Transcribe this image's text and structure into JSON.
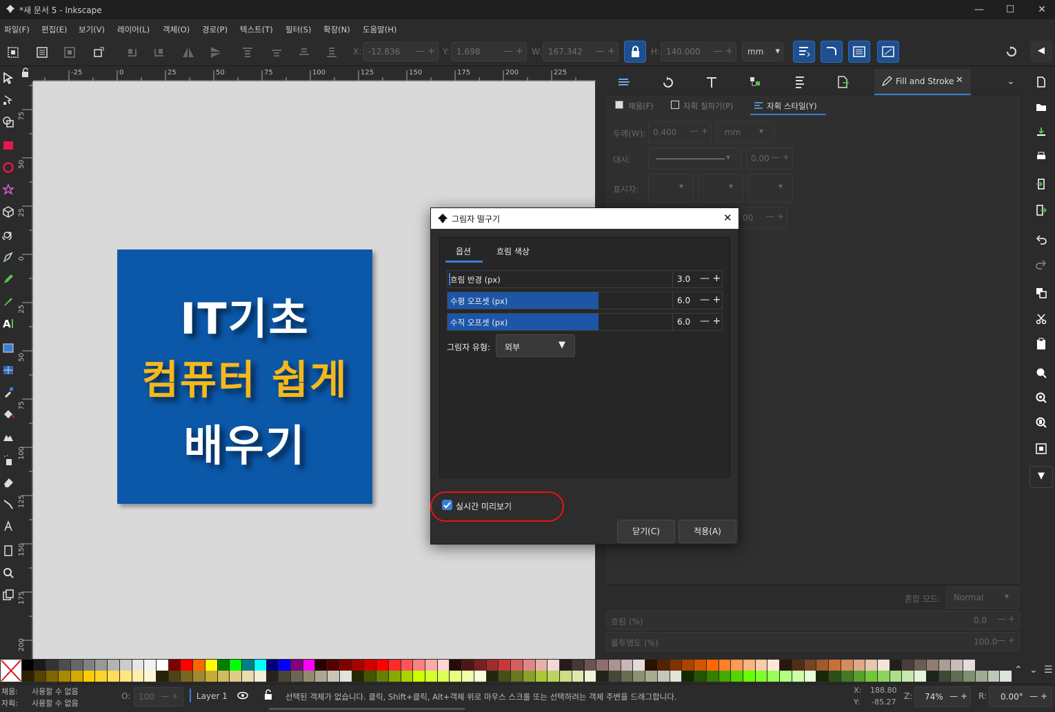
{
  "window": {
    "title": "*새 문서 5 - Inkscape",
    "minimize": "—",
    "maximize": "☐",
    "close": "✕"
  },
  "menu": [
    "파일(F)",
    "편집(E)",
    "보기(V)",
    "레이어(L)",
    "객체(O)",
    "경로(P)",
    "텍스트(T)",
    "필터(S)",
    "확장(N)",
    "도움말(H)"
  ],
  "toolbar": {
    "x_label": "X:",
    "x_value": "-12.836",
    "y_label": "Y:",
    "y_value": "1.698",
    "w_label": "W:",
    "w_value": "167.342",
    "h_label": "H:",
    "h_value": "140.000",
    "unit": "mm"
  },
  "ruler_top": [
    "-25",
    "0",
    "25",
    "50",
    "75",
    "100",
    "125",
    "150",
    "175",
    "200",
    "225"
  ],
  "ruler_left": [
    "75",
    "50",
    "25",
    "0",
    "25",
    "50",
    "75",
    "100",
    "125",
    "150",
    "175",
    "200"
  ],
  "artwork": {
    "line1": "IT기초",
    "line2": "컴퓨터 쉽게",
    "line3": "배우기",
    "box_color": "#0b57a8",
    "accent": "#f5b81b"
  },
  "dock": {
    "active_tab": "Fill and Stroke",
    "subtabs": [
      "채움(F)",
      "자획 칠하기(P)",
      "자획 스타일(Y)"
    ],
    "width_label": "두께(W):",
    "width_value": "0.400",
    "width_unit": "mm",
    "dash_label": "대시:",
    "dash_value": "0.00",
    "marker_label": "표시자:",
    "partial_value": "00",
    "blend_label": "혼합 모드:",
    "blend_value": "Normal",
    "blur_label": "흐림 (%)",
    "blur_value": "0.0",
    "opacity_label": "불투명도 (%)",
    "opacity_value": "100.0"
  },
  "dialog": {
    "title": "그림자 떨구기",
    "tabs": [
      "옵션",
      "흐림 색상"
    ],
    "blur_radius_label": "흐림 반경 (px)",
    "blur_radius_value": "3.0",
    "blur_radius_fraction": 0.0,
    "h_offset_label": "수평 오프셋 (px)",
    "h_offset_value": "6.0",
    "h_offset_fraction": 0.55,
    "v_offset_label": "수직 오프셋 (px)",
    "v_offset_value": "6.0",
    "v_offset_fraction": 0.55,
    "shadow_type_label": "그림자 유형:",
    "shadow_type_value": "외부",
    "live_preview_label": "실시간 미리보기",
    "close_button": "닫기(C)",
    "apply_button": "적용(A)"
  },
  "status": {
    "fill_label": "채움:",
    "fill_value": "사용할 수 없음",
    "stroke_label": "자획:",
    "stroke_value": "사용할 수 없음",
    "o_label": "O:",
    "o_value": "100",
    "layer": "Layer 1",
    "message": "선택된 객체가 없습니다. 클릭, Shift+클릭, Alt+객체 위로 마우스 스크롤 또는 선택하려는 객체 주변을 드래그합니다.",
    "cx_label": "X:",
    "cx_value": "188.80",
    "cy_label": "Y:",
    "cy_value": "-85.27",
    "zoom_label": "Z:",
    "zoom_value": "74%",
    "rot_label": "R:",
    "rot_value": "0.00°"
  }
}
